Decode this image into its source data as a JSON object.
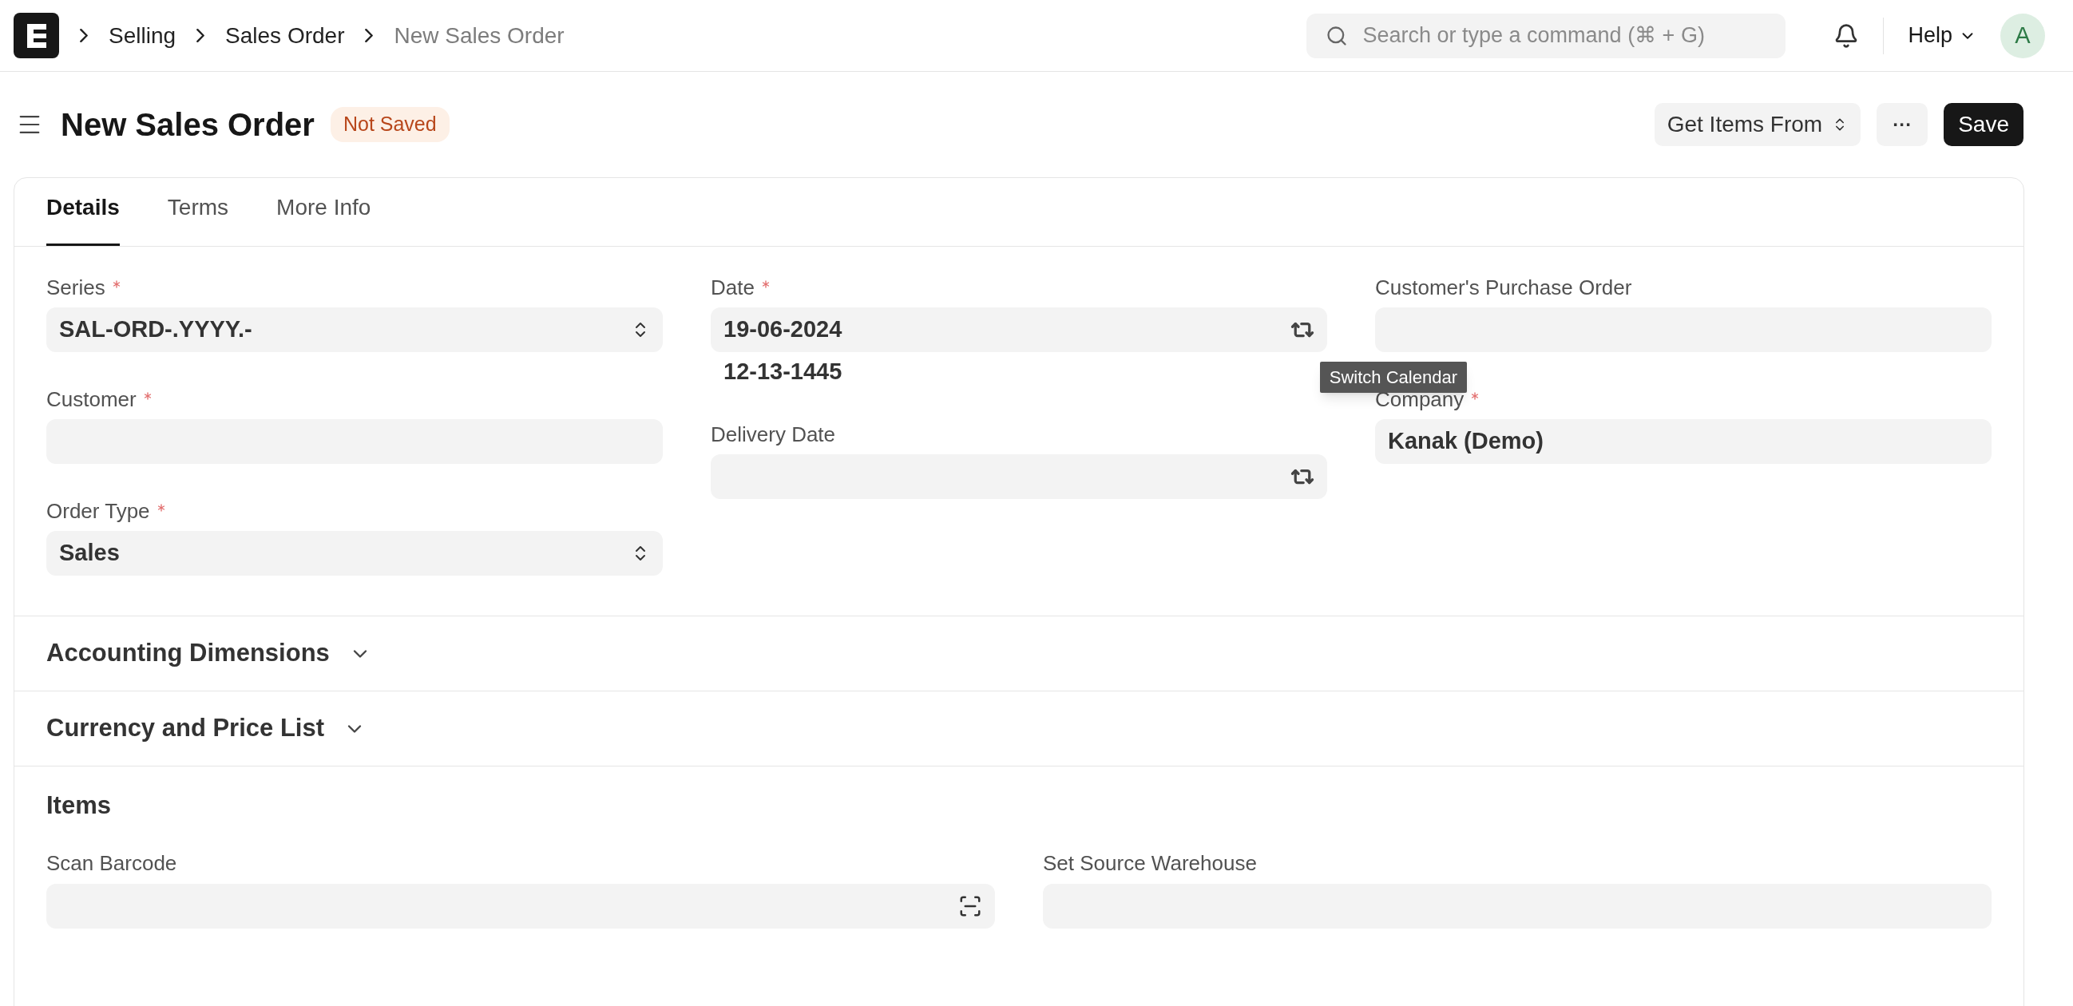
{
  "topbar": {
    "breadcrumbs": [
      {
        "label": "Selling",
        "current": false
      },
      {
        "label": "Sales Order",
        "current": false
      },
      {
        "label": "New Sales Order",
        "current": true
      }
    ],
    "search": {
      "placeholder": "Search or type a command (⌘ + G)"
    },
    "help": "Help",
    "avatar": "A"
  },
  "header": {
    "title": "New Sales Order",
    "status": "Not Saved",
    "actions": [
      {
        "kind": "select",
        "label": "Get Items From"
      },
      {
        "kind": "more",
        "label": "···"
      },
      {
        "kind": "primary",
        "label": "Save"
      }
    ]
  },
  "tabs": [
    {
      "label": "Details",
      "selected": true
    },
    {
      "label": "Terms",
      "selected": false
    },
    {
      "label": "More Info",
      "selected": false
    }
  ],
  "details": {
    "columns": [
      [
        {
          "kind": "select",
          "label": "Series",
          "required": true,
          "value": "SAL-ORD-.YYYY.-"
        },
        {
          "kind": "link",
          "label": "Customer",
          "required": true
        },
        {
          "kind": "select",
          "label": "Order Type",
          "required": true,
          "value": "Sales"
        }
      ],
      [
        {
          "kind": "date",
          "label": "Date",
          "required": true,
          "value": "19-06-2024",
          "alt_date": "12-13-1445",
          "tooltip": "Switch Calendar"
        },
        {
          "kind": "date",
          "label": "Delivery Date",
          "required": false
        }
      ],
      [
        {
          "kind": "text",
          "label": "Customer's Purchase Order",
          "required": false
        },
        {
          "kind": "link",
          "label": "Company",
          "required": true,
          "value": "Kanak (Demo)"
        }
      ]
    ]
  },
  "sections": [
    {
      "title": "Accounting Dimensions",
      "collapsible": true
    },
    {
      "title": "Currency and Price List",
      "collapsible": true
    }
  ],
  "items_section": {
    "title": "Items",
    "fields": [
      {
        "kind": "barcode",
        "label": "Scan Barcode",
        "required": false
      },
      {
        "kind": "link",
        "label": "Set Source Warehouse",
        "required": false
      }
    ]
  }
}
